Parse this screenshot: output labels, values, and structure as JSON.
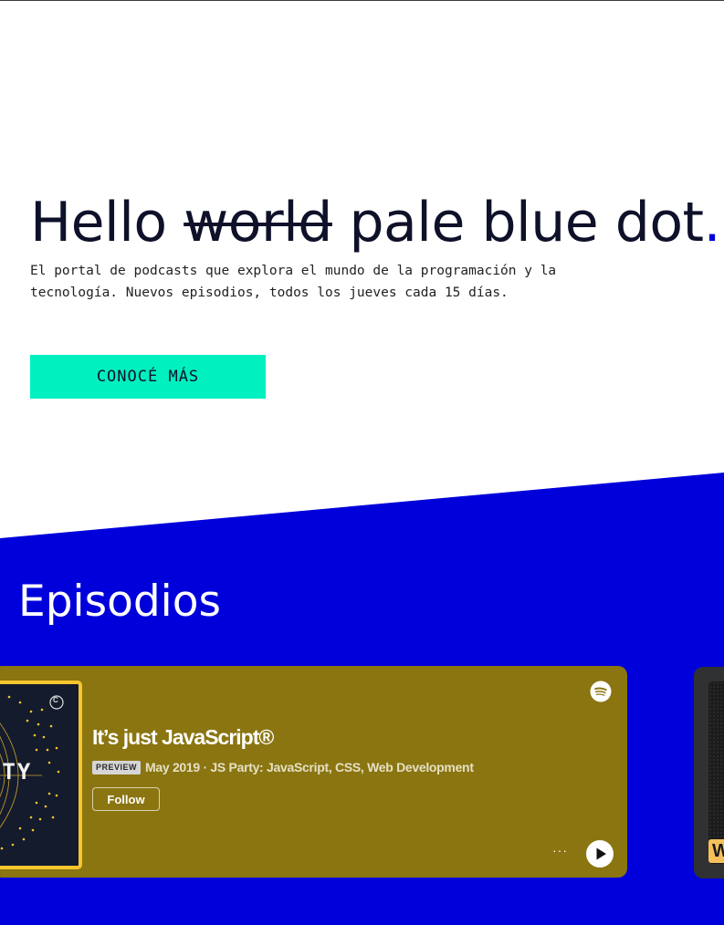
{
  "hero": {
    "title_start": "Hello ",
    "title_struck": "world",
    "title_rest": " pale blue dot",
    "title_dot": ".",
    "subtitle": "El portal de podcasts que explora el mundo de la programación y la tecnología. Nuevos episodios, todos los jueves cada 15 días.",
    "cta_label": "CONOCÉ MÁS"
  },
  "episodes": {
    "section_title": "Episodios",
    "cards": [
      {
        "cover_text": "RTY",
        "cover_badge": "C",
        "title": "It’s just JavaScript®",
        "badge": "PREVIEW",
        "meta": "May 2019 · JS Party: JavaScript, CSS, Web Development",
        "follow_label": "Follow",
        "more_label": "···",
        "background_color": "#8a7511",
        "cover_border_color": "#f7c52d"
      },
      {
        "cover_tag": "W",
        "background_color": "#2f3132"
      }
    ]
  },
  "colors": {
    "blue": "#0000db",
    "accent": "#00f0c0",
    "text_dark": "#0e1129"
  },
  "icons": {
    "spotify": "spotify-icon",
    "play": "play-icon",
    "more": "more-icon"
  }
}
